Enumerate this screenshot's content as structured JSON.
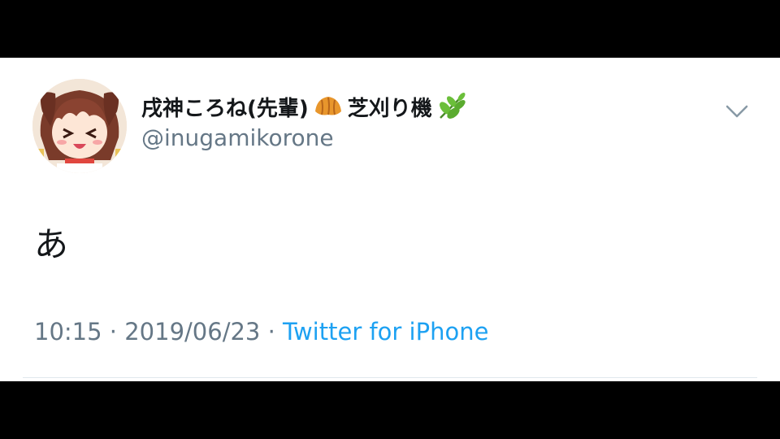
{
  "tweet": {
    "author": {
      "display_name_part1": "戌神ころね(先輩)",
      "display_name_part2": "芝刈り機",
      "emoji_1": "croissant-icon",
      "emoji_2": "herb-icon",
      "handle": "@inugamikorone"
    },
    "text": "あ",
    "time": "10:15",
    "separator_1": "·",
    "date": "2019/06/23",
    "separator_2": "·",
    "source": "Twitter for iPhone"
  },
  "colors": {
    "name": "#14171a",
    "secondary": "#657786",
    "link": "#1da1f2",
    "background": "#ffffff",
    "letterbox": "#000000"
  }
}
